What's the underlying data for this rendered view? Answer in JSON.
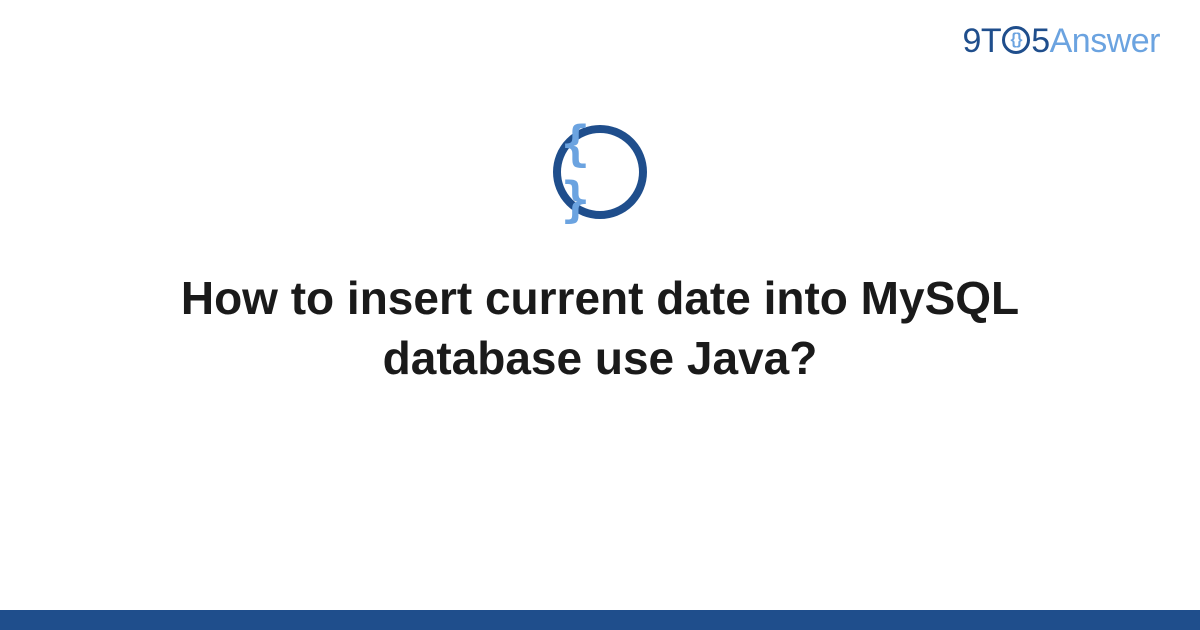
{
  "brand": {
    "prefix": "9T",
    "circle_inner": "{}",
    "suffix": "5",
    "answer": "Answer"
  },
  "icon": {
    "braces": "{ }"
  },
  "title": "How to insert current date into MySQL database use Java?",
  "colors": {
    "primary": "#1f4e8c",
    "secondary": "#6ba3e0"
  }
}
